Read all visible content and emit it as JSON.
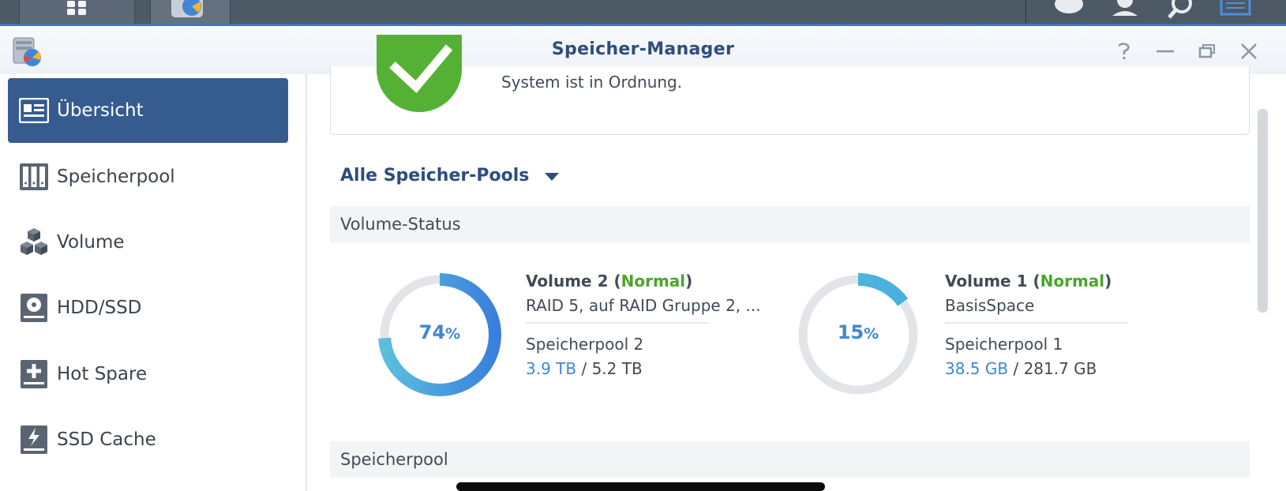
{
  "window": {
    "title": "Speicher-Manager"
  },
  "sidebar": {
    "items": [
      {
        "label": "Übersicht",
        "icon": "overview-icon",
        "active": true
      },
      {
        "label": "Speicherpool",
        "icon": "storage-pool-icon",
        "active": false
      },
      {
        "label": "Volume",
        "icon": "volume-cubes-icon",
        "active": false
      },
      {
        "label": "HDD/SSD",
        "icon": "hdd-icon",
        "active": false
      },
      {
        "label": "Hot Spare",
        "icon": "hot-spare-icon",
        "active": false
      },
      {
        "label": "SSD Cache",
        "icon": "ssd-cache-icon",
        "active": false
      }
    ]
  },
  "status": {
    "text": "System ist in Ordnung.",
    "color": "#55b133"
  },
  "pool_selector": {
    "label": "Alle Speicher-Pools"
  },
  "sections": {
    "volume_status": "Volume-Status",
    "storage_pool": "Speicherpool"
  },
  "volumes": [
    {
      "name": "Volume 2",
      "open": " (",
      "status": "Normal",
      "close": ")",
      "subtitle": "RAID 5, auf RAID Gruppe 2, ...",
      "pool": "Speicherpool 2",
      "used": "3.9 TB",
      "sep": " / ",
      "total": "5.2 TB",
      "percent_value": 74,
      "percent": "74",
      "percent_sign": "%"
    },
    {
      "name": "Volume 1",
      "open": " (",
      "status": "Normal",
      "close": ")",
      "subtitle": "BasisSpace",
      "pool": "Speicherpool 1",
      "used": "38.5 GB",
      "sep": " / ",
      "total": "281.7 GB",
      "percent_value": 15,
      "percent": "15",
      "percent_sign": "%"
    }
  ],
  "colors": {
    "accent": "#2e4d7b",
    "ok": "#4aa52a",
    "usage": "#3f86d6",
    "active_nav": "#365b8f"
  }
}
